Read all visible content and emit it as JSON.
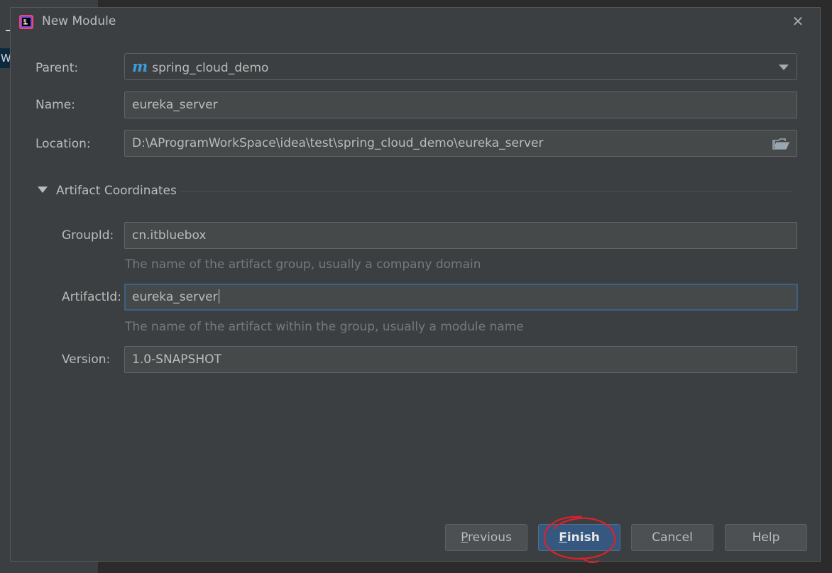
{
  "dialog": {
    "title": "New Module",
    "close_glyph": "✕"
  },
  "background": {
    "left_tab_text": "W"
  },
  "form": {
    "parent": {
      "label": "Parent:",
      "value": "spring_cloud_demo",
      "icon": "m"
    },
    "name": {
      "label": "Name:",
      "value": "eureka_server"
    },
    "location": {
      "label": "Location:",
      "value": "D:\\AProgramWorkSpace\\idea\\test\\spring_cloud_demo\\eureka_server"
    }
  },
  "artifact_section": {
    "title": "Artifact Coordinates",
    "group_id": {
      "label": "GroupId:",
      "value": "cn.itbluebox",
      "hint": "The name of the artifact group, usually a company domain"
    },
    "artifact_id": {
      "label": "ArtifactId:",
      "value": "eureka_server",
      "hint": "The name of the artifact within the group, usually a module name"
    },
    "version": {
      "label": "Version:",
      "value": "1.0-SNAPSHOT"
    }
  },
  "buttons": {
    "previous": {
      "mnemonic": "P",
      "rest": "revious"
    },
    "finish": {
      "mnemonic": "F",
      "rest": "inish"
    },
    "cancel": "Cancel",
    "help": "Help"
  },
  "colors": {
    "dialog_bg": "#3c3f41",
    "field_bg": "#45494a",
    "focus_border": "#3d6185",
    "default_button": "#365880",
    "annotation": "#e0202a"
  }
}
